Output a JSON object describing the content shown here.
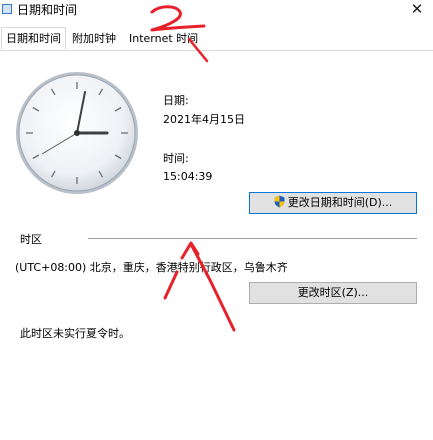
{
  "window": {
    "title": "日期和时间"
  },
  "tabs": [
    "日期和时间",
    "附加时钟",
    "Internet 时间"
  ],
  "datetime": {
    "date_label": "日期:",
    "date_value": "2021年4月15日",
    "time_label": "时间:",
    "time_value": "15:04:39",
    "change_button": "更改日期和时间(D)..."
  },
  "timezone": {
    "heading": "时区",
    "value": "(UTC+08:00) 北京，重庆，香港特别行政区，乌鲁木齐",
    "change_button": "更改时区(Z)...",
    "dst_note": "此时区未实行夏令时。"
  },
  "annotations": {
    "number_label": "2"
  },
  "colors": {
    "annotation_red": "#e8202a",
    "focus_blue": "#0078d7",
    "button_gray": "#e1e1e1"
  },
  "icons": {
    "close": "close-icon",
    "shield": "uac-shield-icon",
    "app": "calendar-app-icon"
  }
}
